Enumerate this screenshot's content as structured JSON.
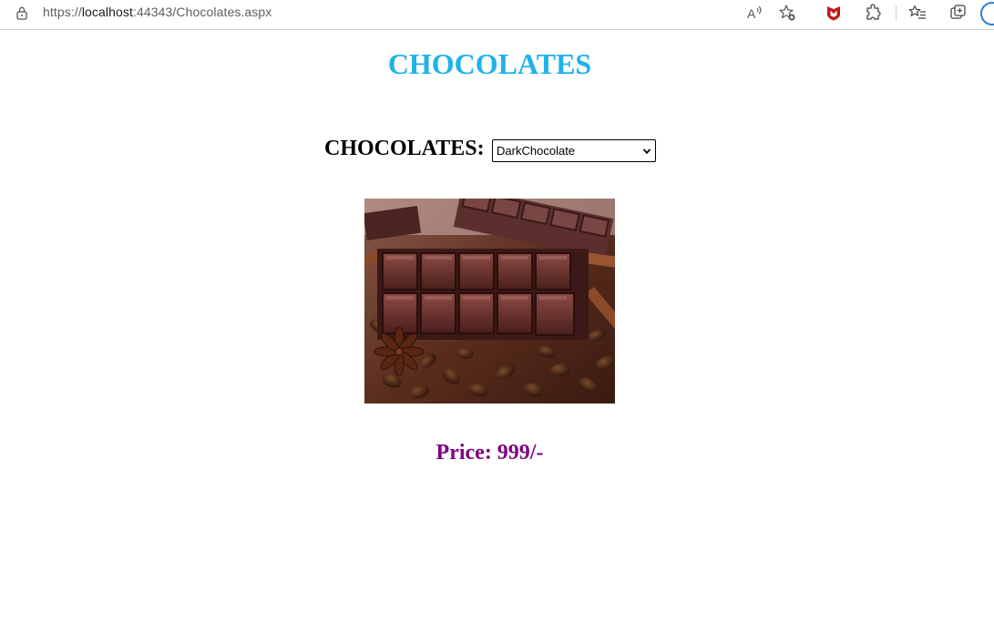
{
  "browser": {
    "url_prefix": "https://",
    "url_host": "localhost",
    "url_rest": ":44343/Chocolates.aspx"
  },
  "page": {
    "title": "CHOCOLATES",
    "selector_label": "CHOCOLATES:",
    "selected_option": "DarkChocolate",
    "price_text": "Price: 999/-"
  },
  "colors": {
    "title": "#1fb2ea",
    "price": "#800080"
  }
}
